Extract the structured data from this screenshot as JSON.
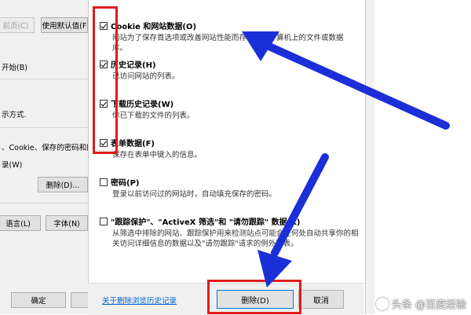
{
  "background_dialog": {
    "buttons": {
      "prev": "前页(C)",
      "use_default": "使用默认值(F",
      "delete": "删除(D)...",
      "languages": "语言(L)",
      "fonts": "字体(N)",
      "ok": "确定"
    },
    "texts": {
      "start": "开始(B)",
      "mode": "示方式.",
      "cookie_line": "、Cookie、保存的密码和网",
      "w_line": "录(W)"
    }
  },
  "delete_history_dialog": {
    "options": [
      {
        "checked": true,
        "title": "Cookie 和网站数据(O)",
        "desc": "网站为了保存首选项或改善网站性能而存储在你计算机上的文件或数据库。"
      },
      {
        "checked": true,
        "title": "历史记录(H)",
        "desc": "已访问网站的列表。"
      },
      {
        "checked": true,
        "title": "下载历史记录(W)",
        "desc": "你已下载的文件的列表。"
      },
      {
        "checked": true,
        "title": "表单数据(F)",
        "desc": "保存在表单中键入的信息。"
      },
      {
        "checked": false,
        "title": "密码(P)",
        "desc": "登录以前访问过的网站时，自动填充保存的密码。"
      },
      {
        "checked": false,
        "title": "\"跟踪保护\"、\"ActiveX 筛选\"和 \"请勿跟踪\" 数据(K)",
        "desc": "从筛选中排除的网站、跟踪保护用来检测站点可能会在何处自动共享你的相关访问详细信息的数据以及\"请勿跟踪\"请求的例外列表。"
      }
    ],
    "about_link": "关于删除浏览历史记录",
    "delete_button": "删除(D)",
    "cancel_button": "取消"
  },
  "watermark": "头条 @百度经验",
  "colors": {
    "highlight_red": "#e01b1b",
    "arrow_blue": "#1b2fd8",
    "link_blue": "#0066cc"
  }
}
